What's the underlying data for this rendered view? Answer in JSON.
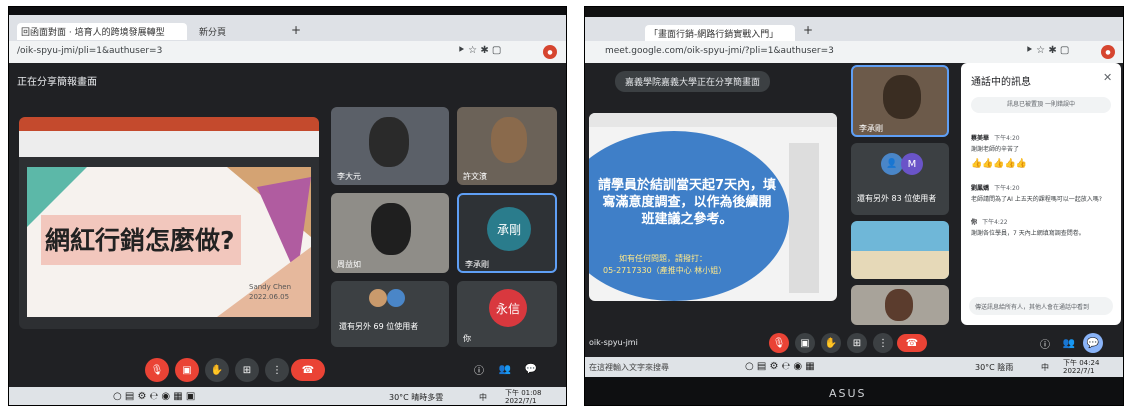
{
  "left": {
    "tab_title": "回函面對面 · 培育人的跨境發展轉型",
    "tab2_title": "新分頁",
    "url": "/oik-spyu-jmi/pli=1&authuser=3",
    "share_banner": "正在分享簡報畫面",
    "slide_heading": "網紅行銷怎麼做?",
    "slide_author": "Sandy Chen",
    "slide_date": "2022.06.05",
    "participants": [
      {
        "label": "李大元"
      },
      {
        "label": "許文濱"
      },
      {
        "label": "周益如"
      },
      {
        "label": "李承剛",
        "avatar": "承剛"
      },
      {
        "label": "還有另外 69 位使用者"
      },
      {
        "label": "你",
        "avatar": "永信"
      }
    ],
    "taskbar": {
      "weather": "30°C 晴時多雲",
      "lang": "中",
      "time": "下午 01:08",
      "date": "2022/7/1"
    },
    "colors": {
      "avatar1": "#2a7c8c",
      "avatar2": "#d9383e",
      "end_call": "#ea4335"
    }
  },
  "right": {
    "tab_title": "「畫面行銷-網路行銷實戰入門」",
    "url": "meet.google.com/oik-spyu-jmi/?pli=1&authuser=3",
    "share_banner": "嘉義學院嘉義大學正在分享簡畫面",
    "slide_text": "請學員於結訓當天起7天內，填寫滿意度調查，以作為後續開班建議之參考。",
    "slide_contact_line1": "如有任何問題，請撥打：",
    "slide_contact_line2": "05-2717330（產推中心 林小姐）",
    "participants": [
      {
        "label": "李承剛"
      },
      {
        "label": "還有另外 83 位使用者"
      }
    ],
    "meeting_code": "oik-spyu-jmi",
    "chat": {
      "title": "通話中的訊息",
      "pin_hint": "訊息已被置頂 一則錯誤中",
      "messages": [
        {
          "sender": "蔡美華",
          "time": "下午4:20",
          "text": "謝謝老師的辛苦了"
        },
        {
          "sender": "",
          "time": "",
          "text": "👍👍👍👍👍"
        },
        {
          "sender": "劉鳳嬌",
          "time": "下午4:20",
          "text": "老師請問為了AI 上五天的課程嗎可以一起放入嗎?"
        },
        {
          "sender": "你",
          "time": "下午4:22",
          "text": "謝謝各位學員，7 天內上網填寫調查問卷。"
        }
      ],
      "input_placeholder": "傳送訊息給所有人，其他人會在通話中看到"
    },
    "taskbar": {
      "search_placeholder": "在這裡輸入文字來搜尋",
      "weather": "30°C 陰雨",
      "lang": "中",
      "time": "下午 04:24",
      "date": "2022/7/1"
    },
    "monitor_brand": "ASUS",
    "colors": {
      "slide_blue": "#3f7fc8",
      "avatar_m": "#6a54c8",
      "end_call": "#ea4335"
    }
  }
}
